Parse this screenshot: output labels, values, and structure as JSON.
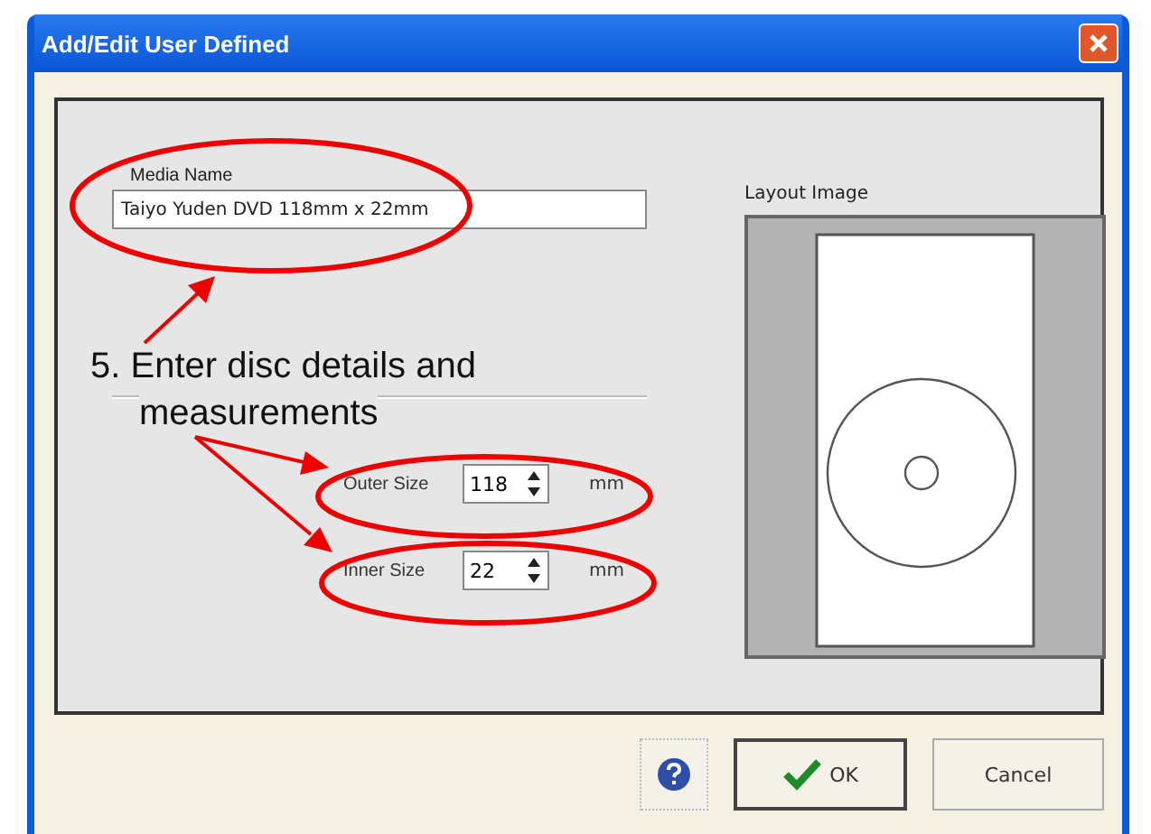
{
  "window": {
    "title": "Add/Edit User Defined"
  },
  "media_name": {
    "label": "Media Name",
    "value": "Taiyo Yuden DVD 118mm x 22mm"
  },
  "layout_image": {
    "label": "Layout Image"
  },
  "sizes": [
    {
      "label": "Outer Size",
      "value": "118",
      "unit": "mm"
    },
    {
      "label": "Inner Size",
      "value": "22",
      "unit": "mm"
    }
  ],
  "buttons": [
    {
      "kind": "help"
    },
    {
      "kind": "ok",
      "label": "OK"
    },
    {
      "kind": "cancel",
      "label": "Cancel"
    }
  ],
  "annotation": {
    "lines": [
      "5. Enter disc details and",
      "measurements"
    ]
  }
}
